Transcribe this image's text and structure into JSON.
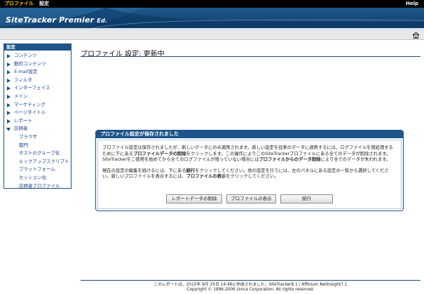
{
  "top_menu": {
    "profile": "プロファイル",
    "settings": "設定",
    "help": "Help"
  },
  "brand": {
    "logo": "SiteTracker Premier",
    "edition": "Ed."
  },
  "sidebar": {
    "header": "設定",
    "items": [
      {
        "label": "コンテンツ"
      },
      {
        "label": "動的コンテンツ"
      },
      {
        "label": "E-mail設定"
      },
      {
        "label": "フィルタ"
      },
      {
        "label": "インターフェイス"
      },
      {
        "label": "メイン"
      },
      {
        "label": "マーケティング"
      },
      {
        "label": "ページタイトル"
      },
      {
        "label": "レポート"
      },
      {
        "label": "訪問者"
      }
    ],
    "subitems": [
      {
        "label": "ブラウザ"
      },
      {
        "label": "都門"
      },
      {
        "label": "ホストのグループ化"
      },
      {
        "label": "ルックアップスクリプト"
      },
      {
        "label": "プラットフォーム"
      },
      {
        "label": "セッション化"
      },
      {
        "label": "訪問者プロファイル"
      }
    ]
  },
  "page": {
    "title": "プロファイル 設定: 更新中"
  },
  "dialog": {
    "title": "プロファイル設定が保存されました",
    "p1_a": "プロファイル設定は保存されましたが、新しいデータにのみ適用されます。新しい設定を従来のデータに適用するには、ログファイルを再処理するために下にある",
    "p1_b": "プロファイルデータの削除",
    "p1_c": "をクリックします。この操作によりこのSiteTrackerプロファイルにある全てのデータが削除されます。SiteTrackerをご使用を始めてから全てのログファイルが残っていない場合には",
    "p1_d": "プロファイルからのデータ削除",
    "p1_e": "により全てのデータが失われます。",
    "p2_a": "現在の設定の編集を続けるには、下にある",
    "p2_b": "続行",
    "p2_c": "をクリックしてください。他の設定を行うには、左のパネルにある設定の一覧から選択してください。新しいプロファイルを表示するには、",
    "p2_d": "プロファイルの表示",
    "p2_e": "をクリックしてください。",
    "btn_delete": "レポートデータの削除",
    "btn_view": "プロファイルの表示",
    "btn_continue": "続行"
  },
  "footer": {
    "line1": "このレポートは、2015年 8月 25日 14:48に作成されました。SiteTracker8.1 / Affinium NetInsight7.1",
    "line2": "Copyright © 1996-2006 Unica Corporation. All rights reserved."
  }
}
